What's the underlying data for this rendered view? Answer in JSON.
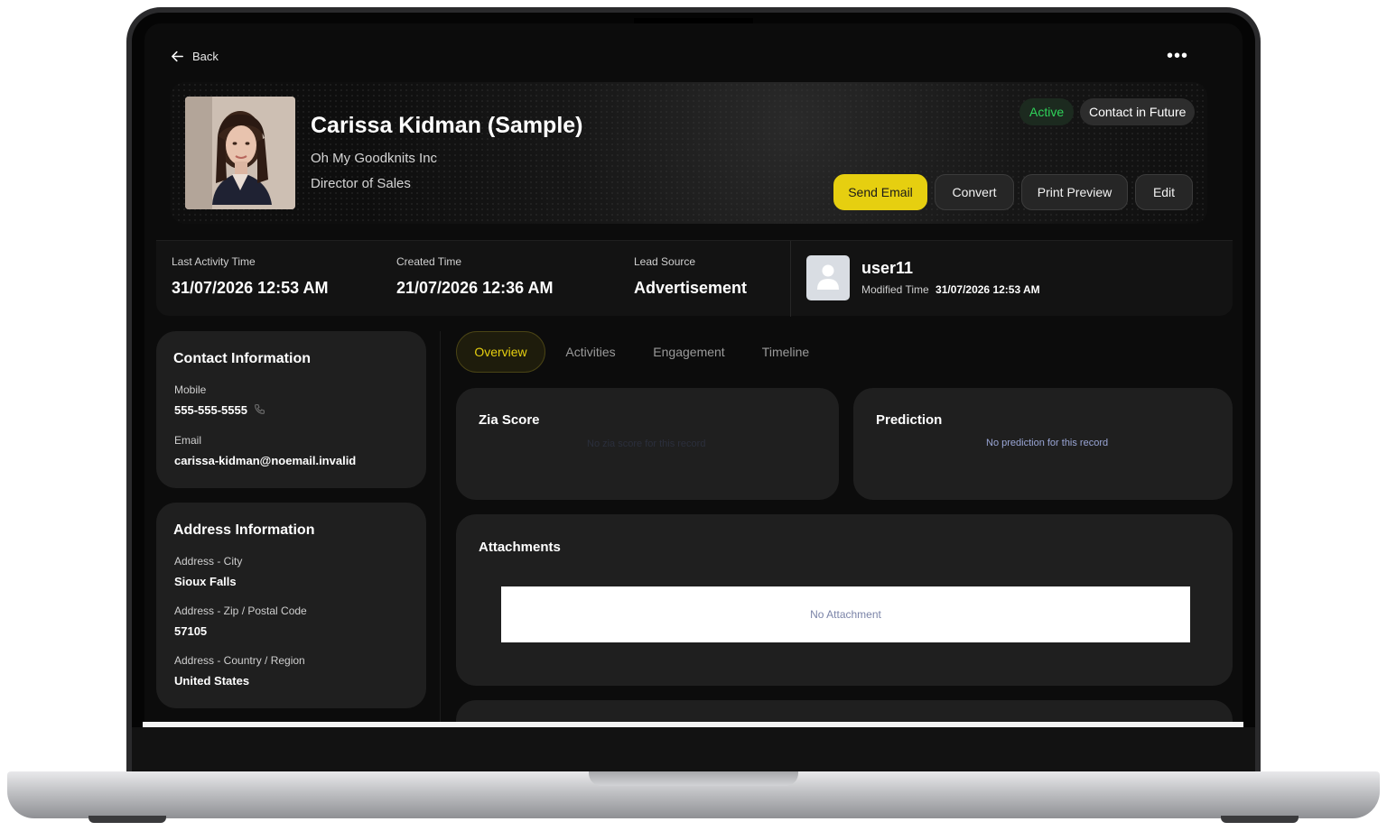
{
  "header": {
    "back_label": "Back",
    "more_label": "•••"
  },
  "profile": {
    "name": "Carissa Kidman (Sample)",
    "company": "Oh My Goodknits Inc",
    "title": "Director of Sales",
    "badges": {
      "status": "Active",
      "stage": "Contact in Future"
    },
    "actions": {
      "send_email": "Send Email",
      "convert": "Convert",
      "print_preview": "Print Preview",
      "edit": "Edit"
    }
  },
  "stats": {
    "last_activity": {
      "label": "Last Activity Time",
      "value": "31/07/2026 12:53 AM"
    },
    "created": {
      "label": "Created Time",
      "value": "21/07/2026 12:36 AM"
    },
    "lead_source": {
      "label": "Lead Source",
      "value": "Advertisement"
    },
    "owner": {
      "name": "user11",
      "modified_label": "Modified Time",
      "modified_value": "31/07/2026 12:53 AM"
    }
  },
  "contact_info": {
    "title": "Contact Information",
    "mobile_label": "Mobile",
    "mobile_value": "555-555-5555",
    "email_label": "Email",
    "email_value": "carissa-kidman@noemail.invalid"
  },
  "address_info": {
    "title": "Address Information",
    "city_label": "Address - City",
    "city_value": "Sioux Falls",
    "zip_label": "Address - Zip / Postal Code",
    "zip_value": "57105",
    "country_label": "Address - Country / Region",
    "country_value": "United States"
  },
  "tabs": [
    {
      "label": "Overview"
    },
    {
      "label": "Activities"
    },
    {
      "label": "Engagement"
    },
    {
      "label": "Timeline"
    }
  ],
  "zia": {
    "title": "Zia Score",
    "empty": "No zia score for this record"
  },
  "prediction": {
    "title": "Prediction",
    "empty": "No prediction for this record"
  },
  "attachments": {
    "title": "Attachments",
    "empty": "No Attachment"
  },
  "colors": {
    "accent": "#e6cf10",
    "active_green": "#2fd35a",
    "background": "#0c0c0c",
    "card": "#1f1f1f"
  }
}
